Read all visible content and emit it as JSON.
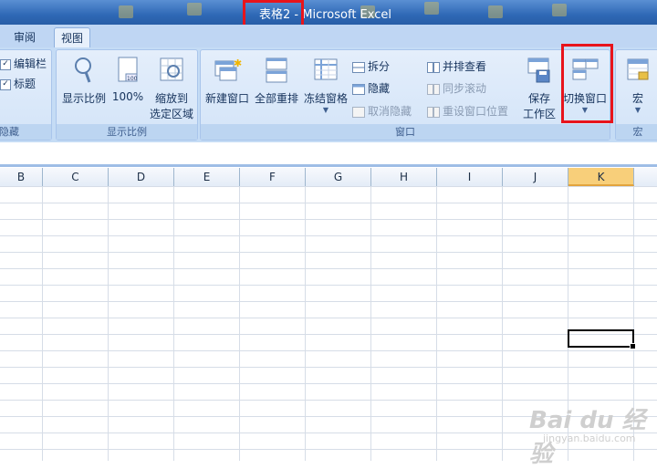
{
  "window": {
    "title_doc": "表格2",
    "title_sep": " - ",
    "title_app": "Microsoft Excel"
  },
  "tabs": [
    {
      "label": "审阅",
      "active": false
    },
    {
      "label": "视图",
      "active": true
    }
  ],
  "ribbon": {
    "show_hide": {
      "items": [
        {
          "label": "编辑栏",
          "checked": true
        },
        {
          "label": "标题",
          "checked": true
        }
      ],
      "group_label": "隐藏"
    },
    "zoom": {
      "zoom_label": "显示比例",
      "zoom100_label": "100%",
      "zoom_sel_line1": "缩放到",
      "zoom_sel_line2": "选定区域",
      "group_label": "显示比例"
    },
    "window": {
      "new_window": "新建窗口",
      "arrange_all": "全部重排",
      "freeze_panes": "冻结窗格",
      "split": "拆分",
      "hide": "隐藏",
      "unhide": "取消隐藏",
      "side_by_side": "并排查看",
      "sync_scroll": "同步滚动",
      "reset_position": "重设窗口位置",
      "save_ws_line1": "保存",
      "save_ws_line2": "工作区",
      "switch_windows": "切换窗口",
      "group_label": "窗口"
    },
    "macros": {
      "label": "宏",
      "group_label": "宏"
    }
  },
  "columns": [
    "B",
    "C",
    "D",
    "E",
    "F",
    "G",
    "H",
    "I",
    "J",
    "K"
  ],
  "selected_column": "K",
  "watermark": {
    "text": "Bai du 经验",
    "url": "jingyan.baidu.com"
  },
  "colors": {
    "accent": "#2f69b6",
    "highlight": "#e8141b",
    "selected_header": "#f8cf7a"
  }
}
